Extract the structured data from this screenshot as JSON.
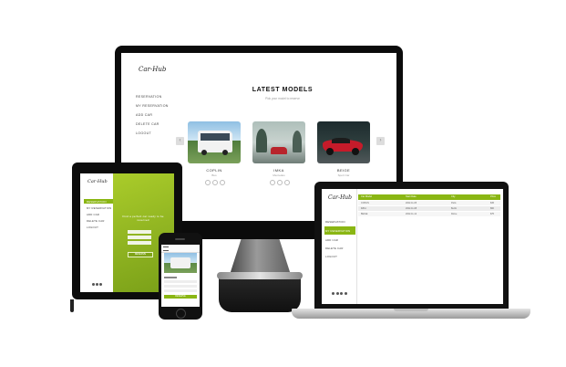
{
  "brand": "Car-Hub",
  "desktop": {
    "nav": [
      "RESERVATION",
      "MY RESERVATION",
      "ADD CAR",
      "DELETE CAR",
      "LOGOUT"
    ],
    "title": "LATEST MODELS",
    "subtitle": "Pick your model to reserve",
    "cards": [
      {
        "name": "COPLIN",
        "sub": "Bus"
      },
      {
        "name": "IMKA",
        "sub": "Mercedes"
      },
      {
        "name": "BEIGE",
        "sub": "Sport Car"
      }
    ]
  },
  "tablet": {
    "nav": [
      "RESERVATION",
      "MY RESERVATION",
      "ADD CAR",
      "DELETE CAR",
      "LOGOUT"
    ],
    "headline": "Find a perfect car ready to be reserved",
    "button": "RESERVE"
  },
  "phone": {
    "button": "RESERVE"
  },
  "laptop": {
    "nav": [
      "RESERVATION",
      "MY RESERVATION",
      "ADD CAR",
      "DELETE CAR",
      "LOGOUT"
    ],
    "columns": [
      "Car Model",
      "Start Date",
      "City",
      "Price"
    ],
    "rows": [
      [
        "COPLIN",
        "2022-11-05",
        "Paris",
        "$45"
      ],
      [
        "IMKA",
        "2022-11-08",
        "Berlin",
        "$60"
      ],
      [
        "BEIGE",
        "2022-11-12",
        "Rome",
        "$75"
      ]
    ]
  },
  "colors": {
    "accent": "#8ab613",
    "frame": "#0b0b0b"
  }
}
